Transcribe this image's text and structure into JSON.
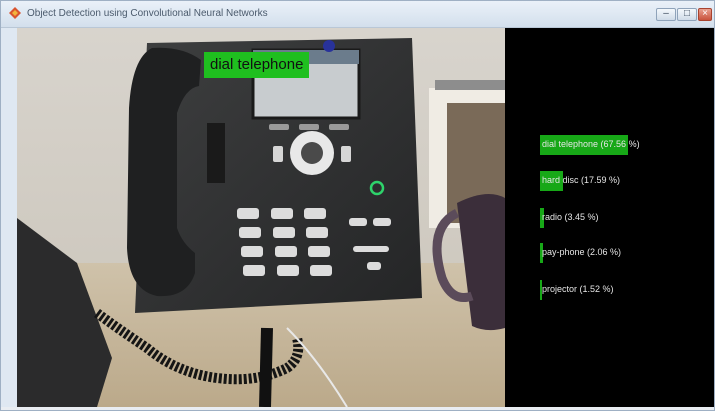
{
  "window": {
    "title": "Object Detection using Convolutional Neural Networks",
    "controls": {
      "minimize": "–",
      "maximize": "□",
      "close": "×"
    }
  },
  "video": {
    "detection_label": "dial telephone"
  },
  "results": [
    {
      "label": "dial telephone (67.56 %)",
      "probability": 0.6756
    },
    {
      "label": "hard disc (17.59 %)",
      "probability": 0.1759
    },
    {
      "label": "radio (3.45 %)",
      "probability": 0.0345
    },
    {
      "label": "pay-phone (2.06 %)",
      "probability": 0.0206
    },
    {
      "label": "projector (1.52 %)",
      "probability": 0.0152
    }
  ],
  "colors": {
    "detection_box": "#1fbf1f",
    "result_bar": "#17a817",
    "panel_bg": "#000000"
  }
}
